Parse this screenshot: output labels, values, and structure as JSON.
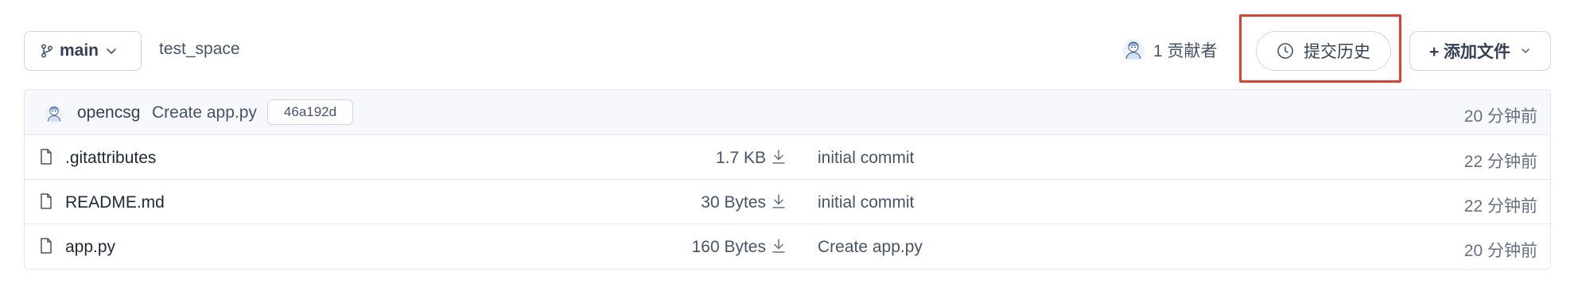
{
  "toolbar": {
    "branch": "main",
    "repo_name": "test_space",
    "contributors": "1 贡献者",
    "history_label": "提交历史",
    "add_file_label": "+ 添加文件"
  },
  "latest_commit": {
    "user": "opencsg",
    "message": "Create app.py",
    "hash": "46a192d",
    "time": "20 分钟前"
  },
  "files": [
    {
      "name": ".gitattributes",
      "size": "1.7 KB",
      "commit": "initial commit",
      "time": "22 分钟前"
    },
    {
      "name": "README.md",
      "size": "30 Bytes",
      "commit": "initial commit",
      "time": "22 分钟前"
    },
    {
      "name": "app.py",
      "size": "160 Bytes",
      "commit": "Create app.py",
      "time": "20 分钟前"
    }
  ],
  "colors": {
    "highlight": "#e0402e",
    "border": "#d0d5dd",
    "header_bg": "#f6f8fb"
  }
}
